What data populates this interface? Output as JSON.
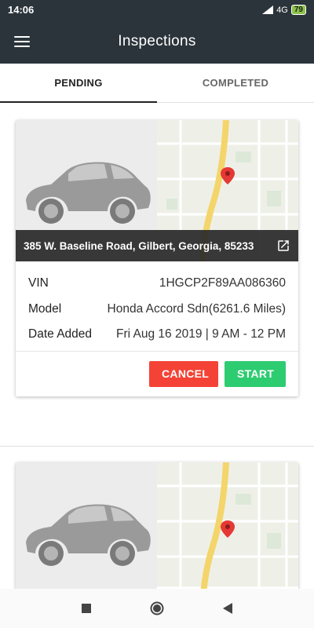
{
  "status_bar": {
    "time": "14:06",
    "network": "4G",
    "battery": "79"
  },
  "app_bar": {
    "title": "Inspections",
    "menu_icon": "hamburger-menu-icon"
  },
  "tabs": [
    {
      "label": "PENDING",
      "active": true
    },
    {
      "label": "COMPLETED",
      "active": false
    }
  ],
  "inspections": [
    {
      "address": "385 W. Baseline Road, Gilbert, Georgia, 85233",
      "fields": [
        {
          "label": "VIN",
          "value": "1HGCP2F89AA086360"
        },
        {
          "label": "Model",
          "value": "Honda Accord Sdn(6261.6 Miles)"
        },
        {
          "label": "Date Added",
          "value": "Fri Aug 16 2019 | 9 AM - 12 PM"
        }
      ],
      "actions": {
        "cancel": "CANCEL",
        "start": "START"
      }
    },
    {
      "address": "",
      "fields": [],
      "actions": {}
    }
  ],
  "colors": {
    "app_bar": "#2b343b",
    "cancel": "#f44336",
    "start": "#2ecc71",
    "map_marker": "#e53935"
  },
  "nav_bar": {
    "icons": [
      "recent-apps-icon",
      "home-icon",
      "back-icon"
    ]
  }
}
